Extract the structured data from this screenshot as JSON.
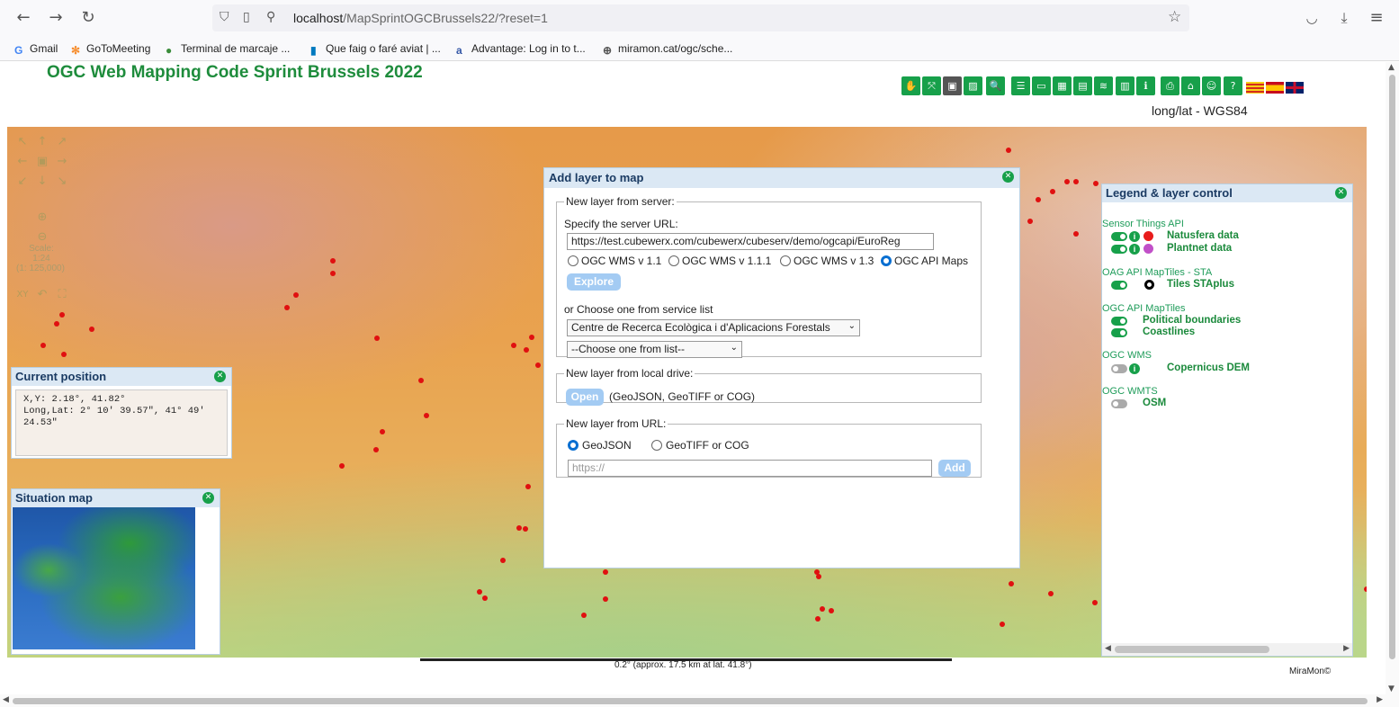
{
  "browser": {
    "back_icon": "←",
    "forward_icon": "→",
    "reload_icon": "↻",
    "url_host": "localhost",
    "url_path": "/MapSprintOGCBrussels22/?reset=1",
    "bookmark_star_icon": "☆",
    "pocket_icon": "◡",
    "download_icon": "⤓",
    "menu_icon": "≡"
  },
  "bookmarks": [
    {
      "label": "Gmail",
      "color": "#4285f4",
      "glyph": "G"
    },
    {
      "label": "GoToMeeting",
      "color": "#f68d2e",
      "glyph": "✻"
    },
    {
      "label": "Terminal de marcaje ...",
      "color": "#3a8c3a",
      "glyph": "●"
    },
    {
      "label": "Que faig o faré aviat | ...",
      "color": "#0079bf",
      "glyph": "▮"
    },
    {
      "label": "Advantage: Log in to t...",
      "color": "#3457a6",
      "glyph": "a"
    },
    {
      "label": "miramon.cat/ogc/sche...",
      "color": "#555555",
      "glyph": "⊕"
    }
  ],
  "app": {
    "title": "OGC Web Mapping Code Sprint Brussels 2022",
    "crs": "long/lat - WGS84",
    "accent_color": "#17a04a"
  },
  "toolbar_icons": [
    "hand-icon",
    "fullextent-icon",
    "camera-icon",
    "image-icon",
    "zoom-icon",
    "adjust-icon",
    "monitor-icon",
    "calendar-icon",
    "table-icon",
    "layers-icon",
    "calculator-icon",
    "info-icon",
    "print-icon",
    "home-icon",
    "users-icon",
    "help-icon",
    "flag-catalan-icon",
    "flag-spanish-icon",
    "flag-uk-icon"
  ],
  "current_position": {
    "title": "Current position",
    "xy": "X,Y: 2.18°, 41.82°",
    "longlat": "Long,Lat: 2° 10' 39.57\", 41° 49' 24.53\""
  },
  "map_nav": {
    "scale_label": "Scale:",
    "scale_value": "1:24",
    "scale_ratio": "(1: 125,000)",
    "xy_label": "XY"
  },
  "situation_map": {
    "title": "Situation map"
  },
  "dialog": {
    "title": "Add layer to map",
    "server_legend": "New layer from server:",
    "server_url_label": "Specify the server URL:",
    "server_url_value": "https://test.cubewerx.com/cubewerx/cubeserv/demo/ogcapi/EuroReg",
    "protocols": [
      "OGC WMS v 1.1",
      "OGC WMS v 1.1.1",
      "OGC WMS v 1.3",
      "OGC API Maps"
    ],
    "protocol_selected": "OGC API Maps",
    "explore_button": "Explore",
    "service_list_label": "or Choose one from service list",
    "service_provider": "Centre de Recerca Ecològica i d'Aplicacions Forestals",
    "service_choice": "--Choose one from list--",
    "local_legend": "New layer from local drive:",
    "open_button": "Open",
    "local_formats": "(GeoJSON, GeoTIFF or COG)",
    "url_legend": "New layer from URL:",
    "url_formats": [
      "GeoJSON",
      "GeoTIFF or COG"
    ],
    "url_format_selected": "GeoJSON",
    "url_placeholder": "https://",
    "add_button": "Add"
  },
  "legend": {
    "title": "Legend & layer control",
    "groups": [
      {
        "category": "Sensor Things API",
        "layers": [
          {
            "name": "Natusfera data",
            "enabled": true,
            "info": true,
            "symbol_color": "#e81c1c"
          },
          {
            "name": "Plantnet data",
            "enabled": true,
            "info": true,
            "symbol_color": "#c150c8"
          }
        ]
      },
      {
        "category": "OAG API MapTiles - STA",
        "layers": [
          {
            "name": "Tiles STAplus",
            "enabled": true,
            "info": false,
            "symbol_color": "#000000"
          }
        ]
      },
      {
        "category": "OGC API MapTiles",
        "layers": [
          {
            "name": "Political boundaries",
            "enabled": true,
            "info": false
          },
          {
            "name": "Coastlines",
            "enabled": true,
            "info": false
          }
        ]
      },
      {
        "category": "OGC WMS",
        "layers": [
          {
            "name": "Copernicus DEM",
            "enabled": false,
            "info": true
          }
        ]
      },
      {
        "category": "OGC WMTS",
        "layers": [
          {
            "name": "OSM",
            "enabled": false,
            "info": false
          }
        ]
      }
    ]
  },
  "scale_bar": {
    "text": "0.2° (approx. 17.5 km at lat. 41.8°)"
  },
  "footer": {
    "credit": "MiraMon©"
  }
}
